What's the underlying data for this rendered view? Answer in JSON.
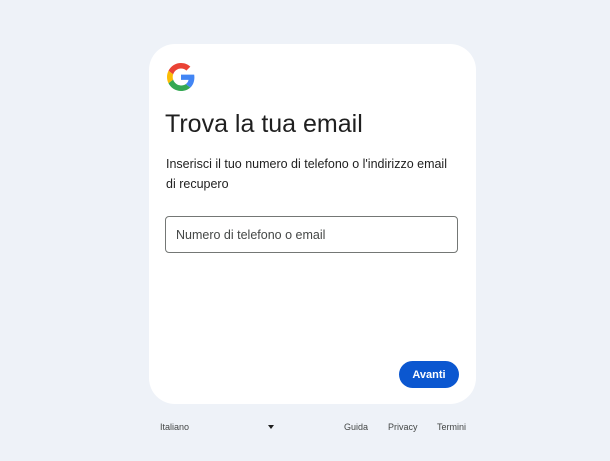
{
  "card": {
    "logo": "google-g-icon",
    "title": "Trova la tua email",
    "subtitle": "Inserisci il tuo numero di telefono o l'indirizzo email di recupero",
    "input": {
      "placeholder": "Numero di telefono o email",
      "value": ""
    },
    "next_label": "Avanti"
  },
  "footer": {
    "language": "Italiano",
    "links": {
      "help": "Guida",
      "privacy": "Privacy",
      "terms": "Termini"
    }
  },
  "colors": {
    "background": "#eef2f8",
    "card": "#ffffff",
    "primary_button": "#0b57d0",
    "google_blue": "#4285F4",
    "google_red": "#EA4335",
    "google_yellow": "#FBBC05",
    "google_green": "#34A853"
  }
}
